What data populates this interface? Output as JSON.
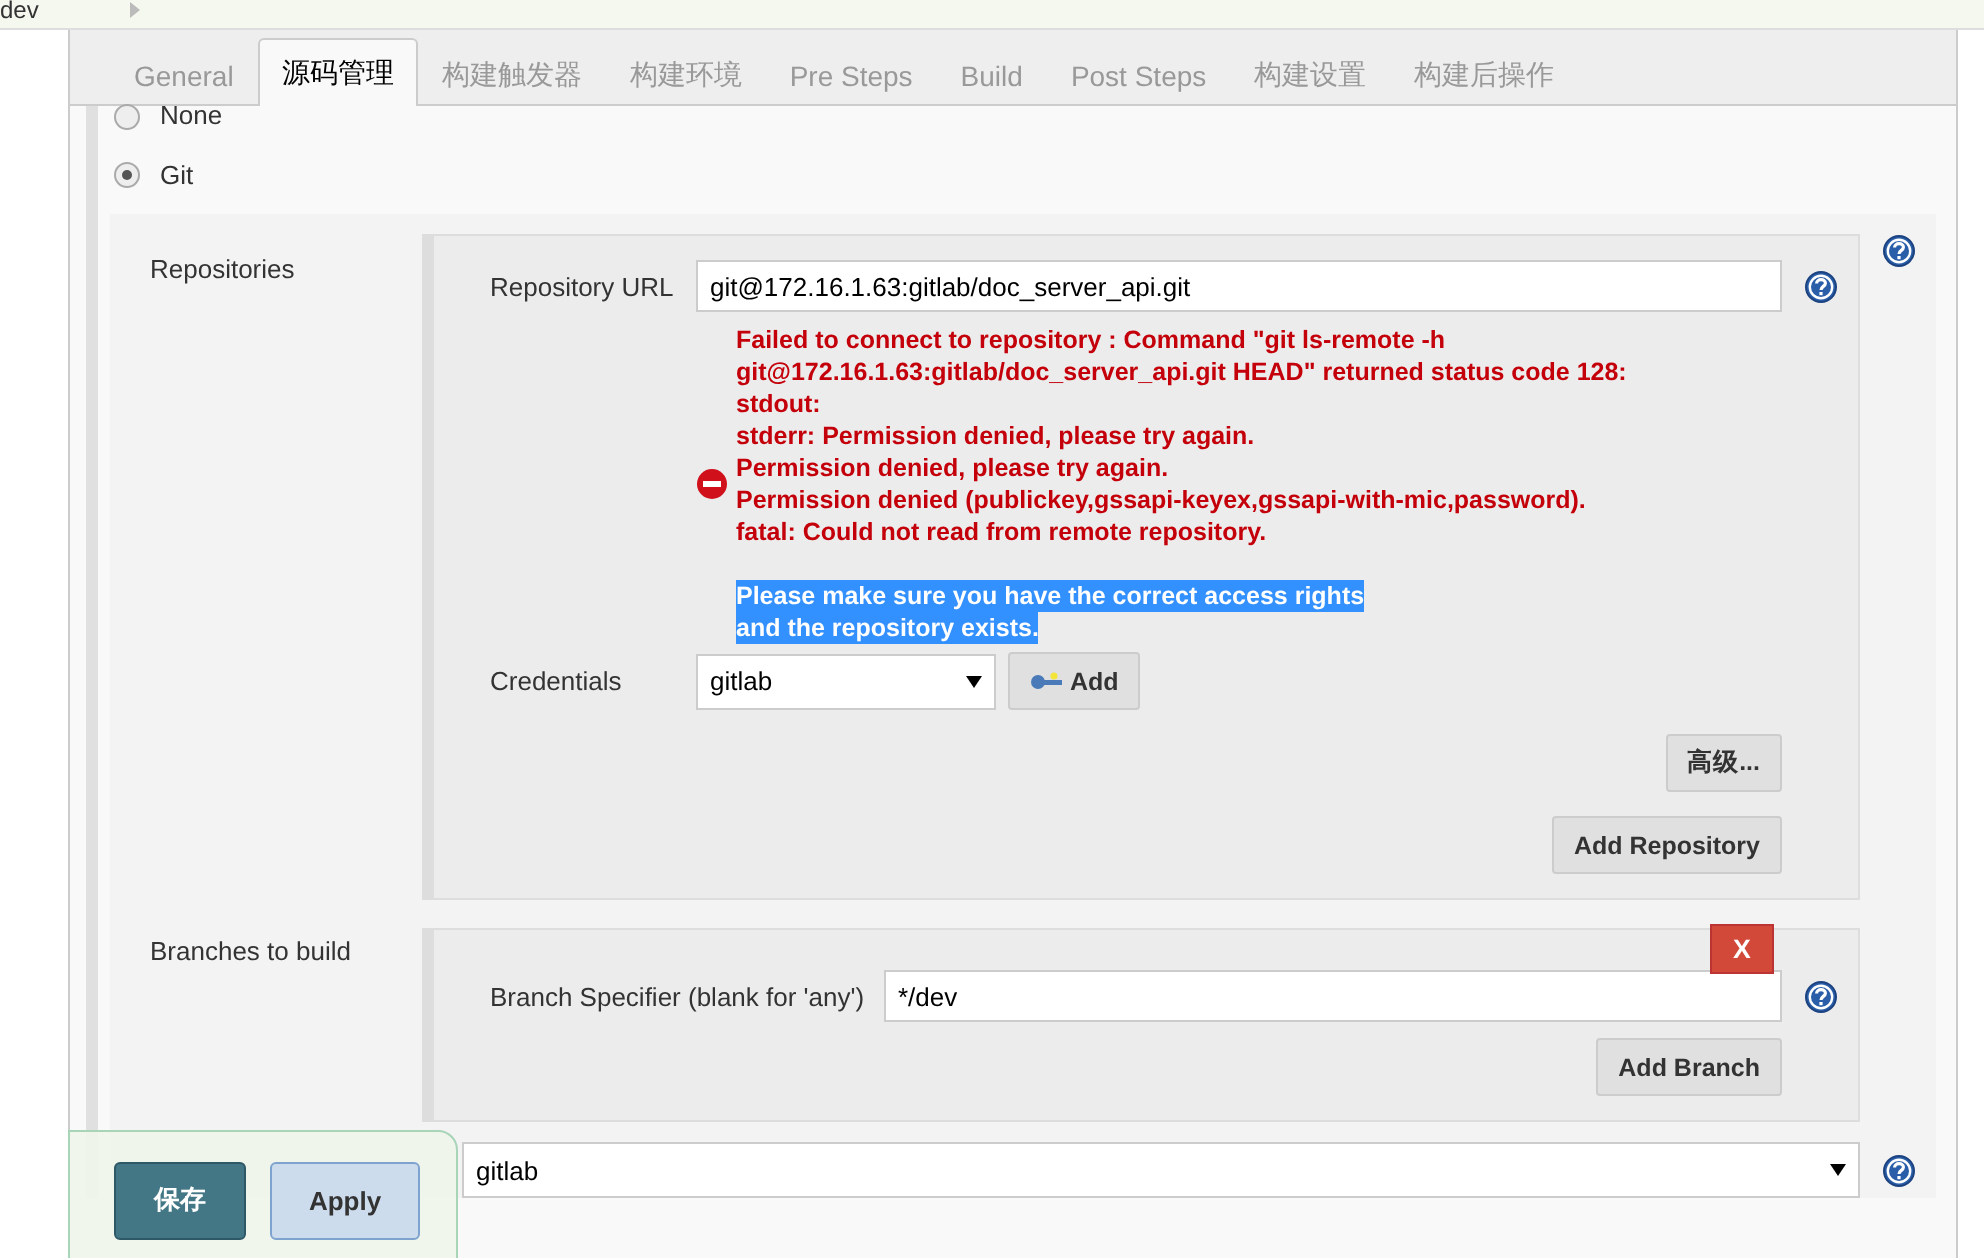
{
  "breadcrumb": {
    "label": "dev"
  },
  "tabs": [
    {
      "label": "General",
      "selected": false
    },
    {
      "label": "源码管理",
      "selected": true
    },
    {
      "label": "构建触发器",
      "selected": false
    },
    {
      "label": "构建环境",
      "selected": false
    },
    {
      "label": "Pre Steps",
      "selected": false
    },
    {
      "label": "Build",
      "selected": false
    },
    {
      "label": "Post Steps",
      "selected": false
    },
    {
      "label": "构建设置",
      "selected": false
    },
    {
      "label": "构建后操作",
      "selected": false
    }
  ],
  "scm_options": [
    {
      "label": "None",
      "selected": false
    },
    {
      "label": "Git",
      "selected": true
    }
  ],
  "repositories": {
    "label": "Repositories",
    "url_label": "Repository URL",
    "url_value": "git@172.16.1.63:gitlab/doc_server_api.git",
    "error_lines": [
      "Failed to connect to repository : Command \"git ls-remote -h",
      "git@172.16.1.63:gitlab/doc_server_api.git HEAD\" returned status code 128:",
      "stdout:",
      "stderr: Permission denied, please try again.",
      "Permission denied, please try again.",
      "Permission denied (publickey,gssapi-keyex,gssapi-with-mic,password).",
      "fatal: Could not read from remote repository."
    ],
    "highlighted_lines": [
      "Please make sure you have the correct access rights",
      "and the repository exists."
    ],
    "credentials_label": "Credentials",
    "credentials_value": "gitlab",
    "add_button": "Add",
    "advanced_button": "高级...",
    "add_repository_button": "Add Repository"
  },
  "branches": {
    "label": "Branches to build",
    "delete_button": "X",
    "specifier_label": "Branch Specifier (blank for 'any')",
    "specifier_value": "*/dev",
    "add_branch_button": "Add Branch"
  },
  "browser": {
    "value": "gitlab"
  },
  "save_bar": {
    "save_button": "保存",
    "apply_button": "Apply"
  }
}
